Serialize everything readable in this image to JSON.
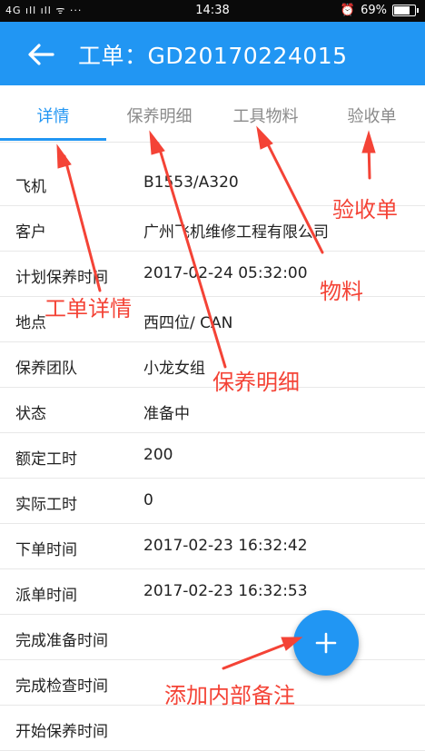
{
  "statusbar": {
    "signal": "4G ıll ıll ᯤ ···",
    "time": "14:38",
    "battery": "69%",
    "battery_level": 0.69
  },
  "appbar": {
    "title": "工单：GD20170224015",
    "back_icon": "arrow-left-icon"
  },
  "tabs": [
    {
      "label": "详情",
      "active": true
    },
    {
      "label": "保养明细",
      "active": false
    },
    {
      "label": "工具物料",
      "active": false
    },
    {
      "label": "验收单",
      "active": false
    }
  ],
  "details": [
    {
      "label": "飞机",
      "value": "B1553/A320"
    },
    {
      "label": "客户",
      "value": "广州飞机维修工程有限公司"
    },
    {
      "label": "计划保养时间",
      "value": "2017-02-24 05:32:00"
    },
    {
      "label": "地点",
      "value": "西四位/ CAN"
    },
    {
      "label": "保养团队",
      "value": "小龙女组"
    },
    {
      "label": "状态",
      "value": "准备中"
    },
    {
      "label": "额定工时",
      "value": "200"
    },
    {
      "label": "实际工时",
      "value": "0"
    },
    {
      "label": "下单时间",
      "value": "2017-02-23 16:32:42"
    },
    {
      "label": "派单时间",
      "value": "2017-02-23 16:32:53"
    },
    {
      "label": "完成准备时间",
      "value": ""
    },
    {
      "label": "完成检查时间",
      "value": ""
    },
    {
      "label": "开始保养时间",
      "value": ""
    }
  ],
  "fab": {
    "icon": "plus-icon"
  },
  "annotations": {
    "ticket_detail": "工单详情",
    "maintenance_detail": "保养明细",
    "material": "物料",
    "acceptance": "验收单",
    "add_note": "添加内部备注"
  },
  "colors": {
    "primary": "#2196f3",
    "annotation": "#f44336",
    "statusbar": "#0a0a0a"
  }
}
